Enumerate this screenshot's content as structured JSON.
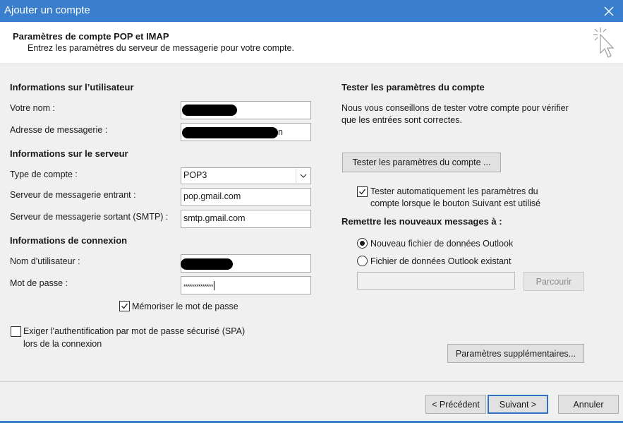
{
  "window": {
    "title": "Ajouter un compte"
  },
  "header": {
    "title": "Paramètres de compte POP et IMAP",
    "subtitle": "Entrez les paramètres du serveur de messagerie pour votre compte."
  },
  "user_info": {
    "heading": "Informations sur l’utilisateur",
    "name_label": "Votre nom :",
    "email_label": "Adresse de messagerie :",
    "email_value_tail": "n"
  },
  "server_info": {
    "heading": "Informations sur le serveur",
    "account_type_label": "Type de compte :",
    "account_type_value": "POP3",
    "incoming_label": "Serveur de messagerie entrant :",
    "incoming_value": "pop.gmail.com",
    "outgoing_label": "Serveur de messagerie sortant (SMTP) :",
    "outgoing_value": "smtp.gmail.com"
  },
  "login_info": {
    "heading": "Informations de connexion",
    "username_label": "Nom d'utilisateur :",
    "password_label": "Mot de passe :",
    "password_value": "**************",
    "remember_label": "Mémoriser le mot de passe",
    "remember_checked": true,
    "spa_label_line1": "Exiger l'authentification par mot de passe sécurisé (SPA)",
    "spa_label_line2": "lors de la connexion",
    "spa_checked": false
  },
  "test": {
    "heading": "Tester les paramètres du compte",
    "desc_line1": "Nous vous conseillons de tester votre compte pour vérifier",
    "desc_line2": "que les entrées sont correctes.",
    "button_label": "Tester les paramètres du compte ...",
    "auto_label_line1": "Tester automatiquement les paramètres du",
    "auto_label_line2": "compte lorsque le bouton Suivant est utilisé",
    "auto_checked": true
  },
  "deliver": {
    "heading": "Remettre les nouveaux messages à :",
    "option_new": "Nouveau fichier de données Outlook",
    "option_existing": "Fichier de données Outlook existant",
    "selected": "new",
    "browse_label": "Parcourir"
  },
  "more_settings_label": "Paramètres supplémentaires...",
  "footer": {
    "prev_label": "< Précédent",
    "next_label": "Suivant >",
    "cancel_label": "Annuler"
  },
  "colors": {
    "titlebar": "#3a7fcd",
    "primary_border": "#2f6fc4"
  },
  "icons": {
    "close": "close-icon",
    "cursor": "cursor-click-icon",
    "chevron": "chevron-down-icon",
    "check": "checkmark-icon"
  }
}
